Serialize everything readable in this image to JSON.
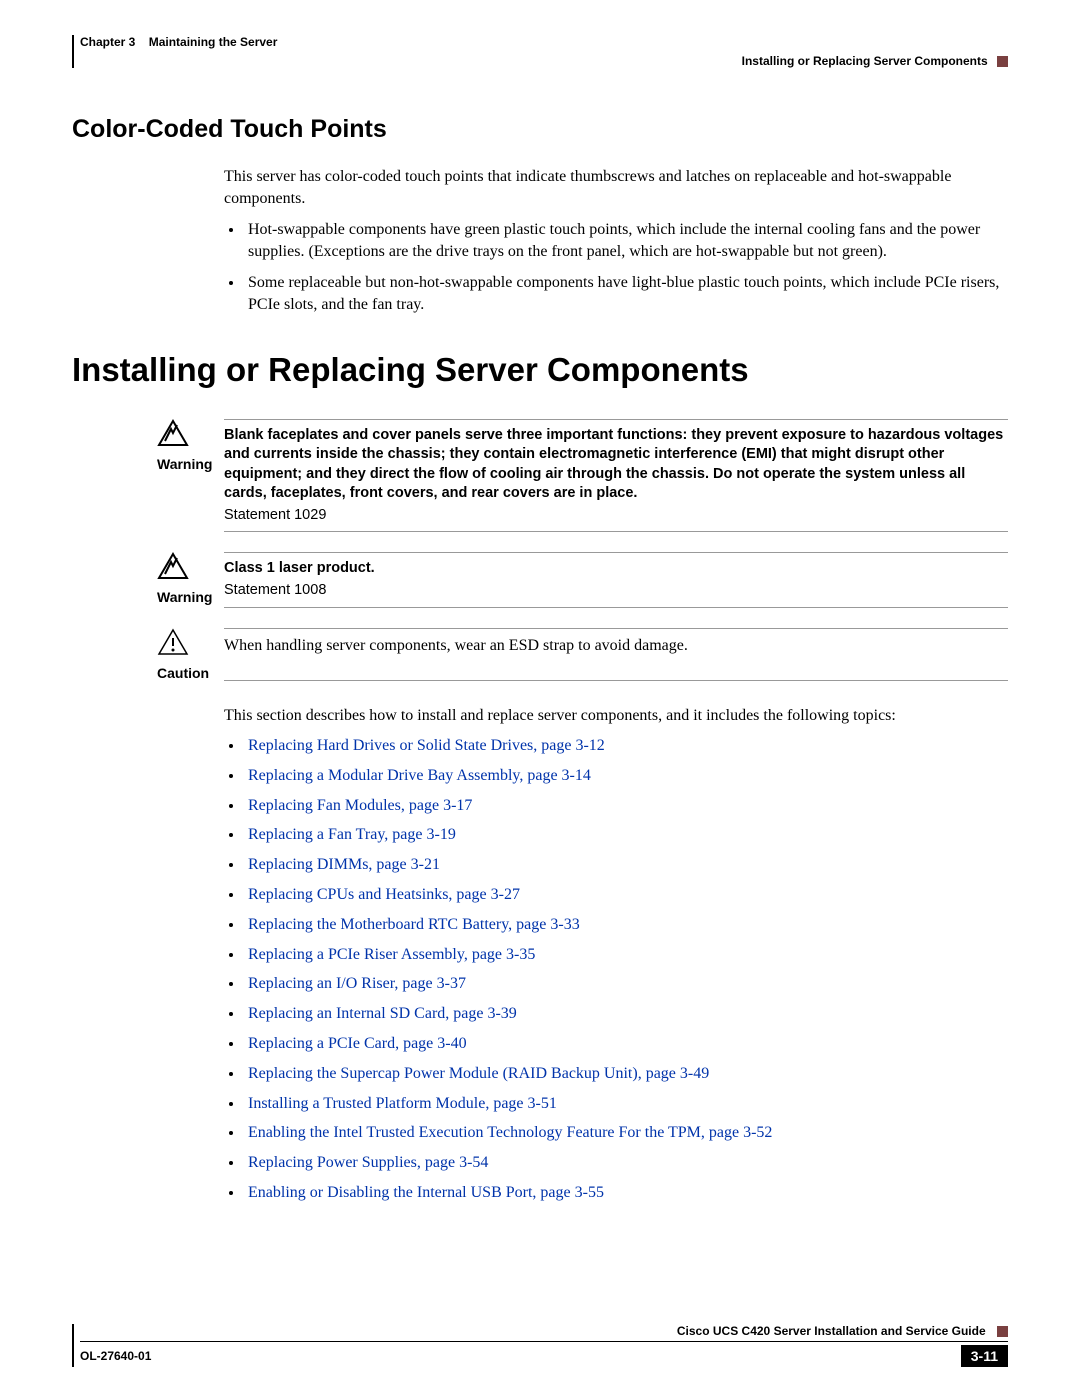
{
  "header": {
    "chapter_label": "Chapter 3",
    "chapter_title": "Maintaining the Server",
    "section_breadcrumb": "Installing or Replacing Server Components"
  },
  "section1": {
    "title": "Color-Coded Touch Points",
    "intro": "This server has color-coded touch points that indicate thumbscrews and latches on replaceable and hot-swappable components.",
    "bullets": [
      "Hot-swappable components have green plastic touch points, which include the internal cooling fans and the power supplies. (Exceptions are the drive trays on the front panel, which are hot-swappable but not green).",
      "Some replaceable but non-hot-swappable components have light-blue plastic touch points, which include PCIe risers, PCIe slots, and the fan tray."
    ]
  },
  "main_heading": "Installing or Replacing Server Components",
  "warning1": {
    "label": "Warning",
    "text": "Blank faceplates and cover panels serve three important functions: they prevent exposure to hazardous voltages and currents inside the chassis; they contain electromagnetic interference (EMI) that might disrupt other equipment; and they direct the flow of cooling air through the chassis. Do not operate the system unless all cards, faceplates, front covers, and rear covers are in place.",
    "statement": "Statement 1029"
  },
  "warning2": {
    "label": "Warning",
    "text": "Class 1 laser product.",
    "statement": "Statement 1008"
  },
  "caution": {
    "label": "Caution",
    "text": "When handling server components, wear an ESD strap to avoid damage."
  },
  "topics_intro": "This section describes how to install and replace server components, and it includes the following topics:",
  "links": [
    "Replacing Hard Drives or Solid State Drives, page 3-12",
    "Replacing a Modular Drive Bay Assembly, page 3-14",
    "Replacing Fan Modules, page 3-17",
    "Replacing a Fan Tray, page 3-19",
    "Replacing DIMMs, page 3-21",
    "Replacing CPUs and Heatsinks, page 3-27",
    "Replacing the Motherboard RTC Battery, page 3-33",
    "Replacing a PCIe Riser Assembly, page 3-35",
    "Replacing an I/O Riser, page 3-37",
    "Replacing an Internal SD Card, page 3-39",
    "Replacing a PCIe Card, page 3-40",
    "Replacing the Supercap Power Module (RAID Backup Unit), page 3-49",
    "Installing a Trusted Platform Module, page 3-51",
    "Enabling the Intel Trusted Execution Technology Feature For the TPM, page 3-52",
    "Replacing Power Supplies, page 3-54",
    "Enabling or Disabling the Internal USB Port, page 3-55"
  ],
  "footer": {
    "guide_title": "Cisco UCS C420 Server Installation and Service Guide",
    "doc_number": "OL-27640-01",
    "page_number": "3-11"
  }
}
